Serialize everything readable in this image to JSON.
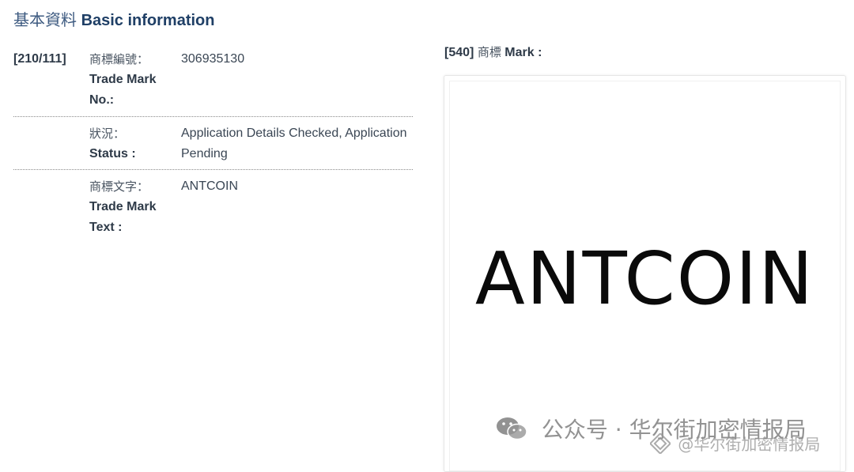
{
  "header": {
    "title_zh": "基本資料",
    "title_en": "Basic information"
  },
  "fields": [
    {
      "code": "[210/111]",
      "label_zh": "商標編號：",
      "label_en": "Trade Mark No.:",
      "value": "306935130"
    },
    {
      "code": "",
      "label_zh": "狀況：",
      "label_en": "Status :",
      "value": "Application Details Checked, Application Pending"
    },
    {
      "code": "",
      "label_zh": "商標文字：",
      "label_en": "Trade Mark Text :",
      "value": "ANTCOIN"
    }
  ],
  "mark": {
    "code": "[540]",
    "label_zh": "商標",
    "label_en": "Mark :",
    "image_text": "ANTCOIN"
  },
  "watermark": {
    "icon": "wechat-icon",
    "text": "公众号 · 华尔街加密情报局",
    "secondary_icon": "binance-square-icon",
    "secondary_text": "@华尔街加密情报局"
  },
  "colors": {
    "heading": "#1f3f66",
    "text": "#3a4654",
    "divider": "#8a8a8a"
  }
}
